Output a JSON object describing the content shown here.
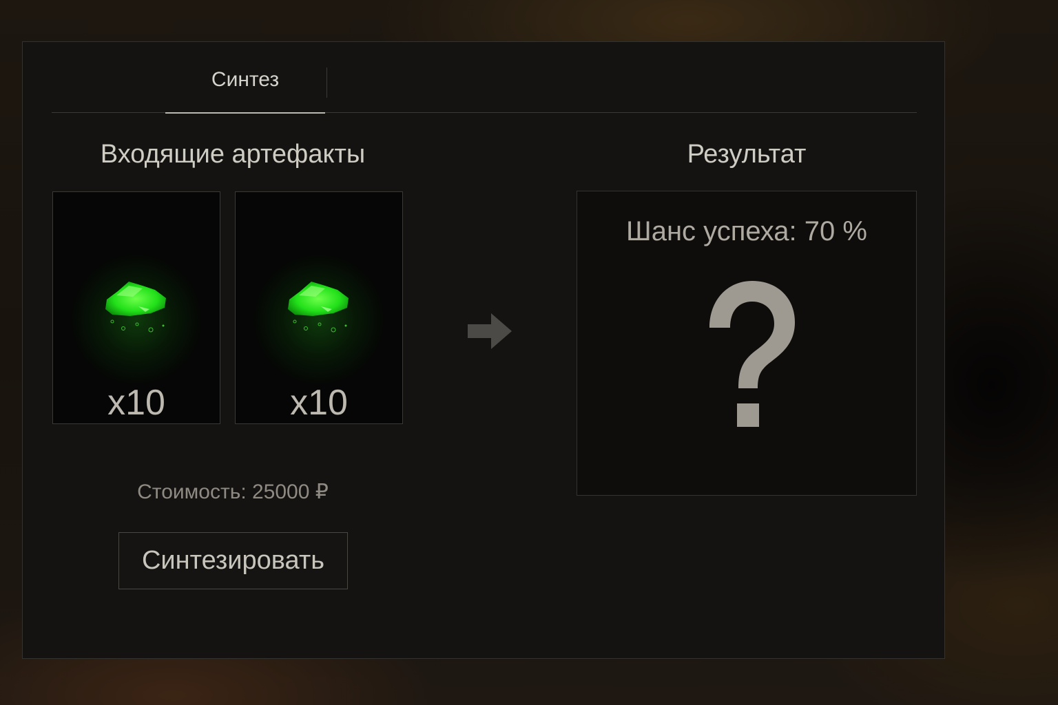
{
  "tabs": [
    {
      "label": "Синтез",
      "active": true
    }
  ],
  "incoming": {
    "title": "Входящие артефакты",
    "slots": [
      {
        "quantity": "x10",
        "icon": "green-crystal-icon"
      },
      {
        "quantity": "x10",
        "icon": "green-crystal-icon"
      }
    ]
  },
  "result": {
    "title": "Результат",
    "chance_text": "Шанс успеха: 70 %",
    "icon": "question-mark-icon"
  },
  "cost": {
    "text": "Стоимость: 25000 ₽"
  },
  "actions": {
    "synthesize_label": "Синтезировать"
  },
  "colors": {
    "artifact_glow": "#22e01a",
    "panel_bg": "#141312",
    "text": "#cfccc4"
  }
}
